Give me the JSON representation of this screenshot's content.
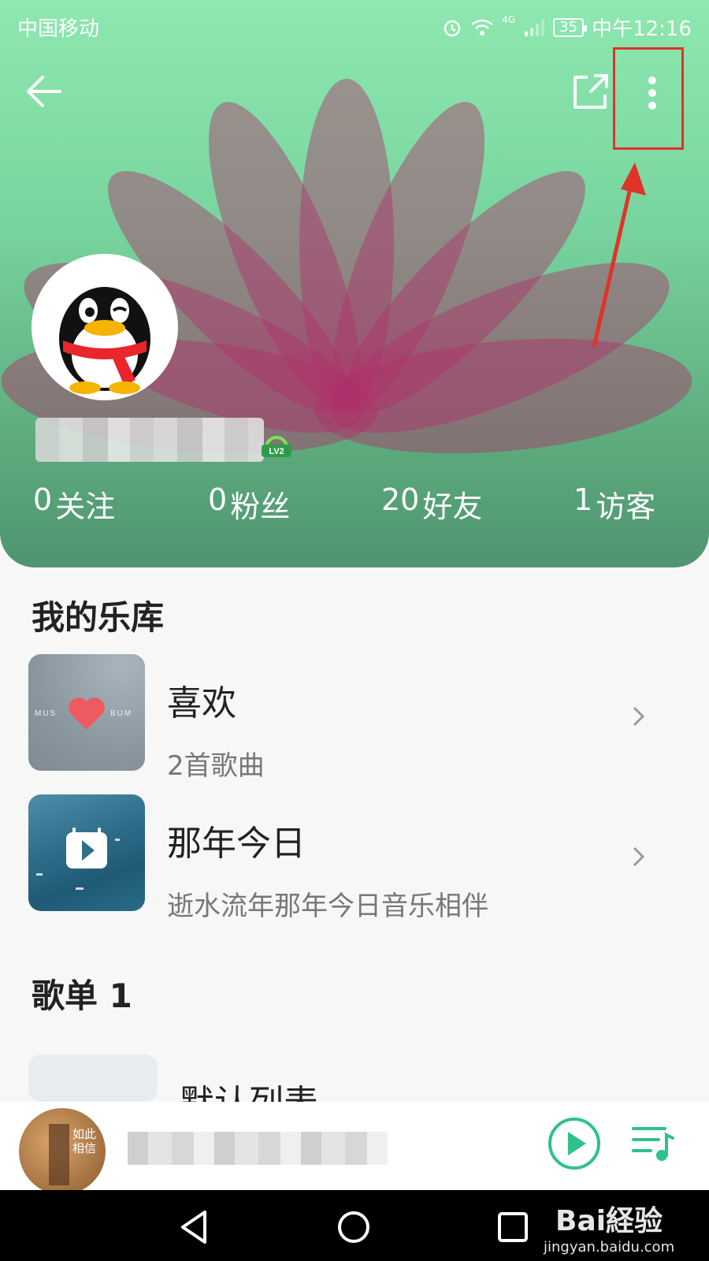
{
  "status_bar": {
    "carrier": "中国移动",
    "network": "4G",
    "battery": "35",
    "time": "中午12:16"
  },
  "profile": {
    "level": "LV2",
    "stats": [
      {
        "num": "0",
        "label": "关注"
      },
      {
        "num": "0",
        "label": "粉丝"
      },
      {
        "num": "20",
        "label": "好友"
      },
      {
        "num": "1",
        "label": "访客"
      }
    ]
  },
  "library": {
    "title": "我的乐库",
    "items": [
      {
        "title": "喜欢",
        "subtitle": "2首歌曲",
        "cover_text_left": "MUS",
        "cover_text_right": "BUM",
        "icon": "heart-icon"
      },
      {
        "title": "那年今日",
        "subtitle": "逝水流年那年今日音乐相伴",
        "icon": "calendar-play-icon"
      }
    ]
  },
  "playlists": {
    "title": "歌单 1",
    "first_item_title": "默认列表"
  },
  "player": {
    "cover_text": "如此 相信"
  },
  "watermark": {
    "logo": "Bai経验",
    "url": "jingyan.baidu.com"
  },
  "colors": {
    "accent": "#2ec28a",
    "highlight": "#e0332a",
    "header_green": "#8ee8b0"
  }
}
